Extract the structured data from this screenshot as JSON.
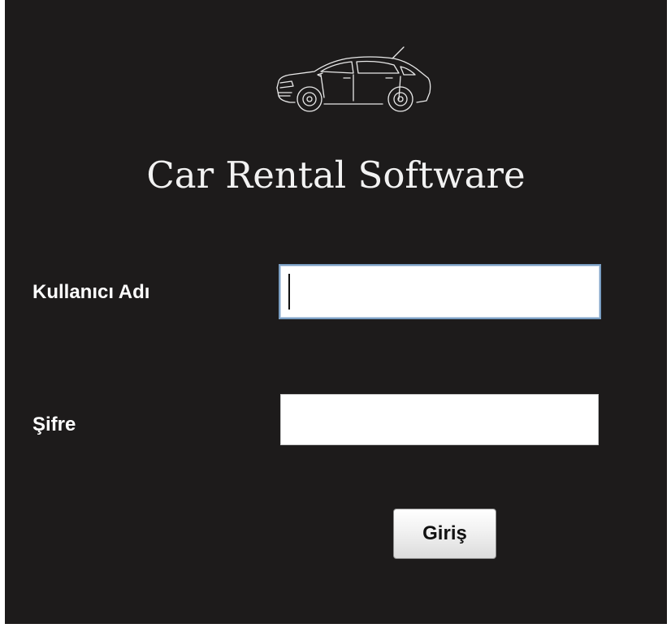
{
  "logo": {
    "icon": "car-icon"
  },
  "title": "Car Rental Software",
  "form": {
    "username_label": "Kullanıcı Adı",
    "username_value": "",
    "password_label": "Şifre",
    "password_value": "",
    "login_button_label": "Giriş"
  },
  "colors": {
    "background": "#1d1b1b",
    "text": "#ffffff",
    "title": "#f2f2f2",
    "input_focus_border": "#7a9ec2"
  }
}
